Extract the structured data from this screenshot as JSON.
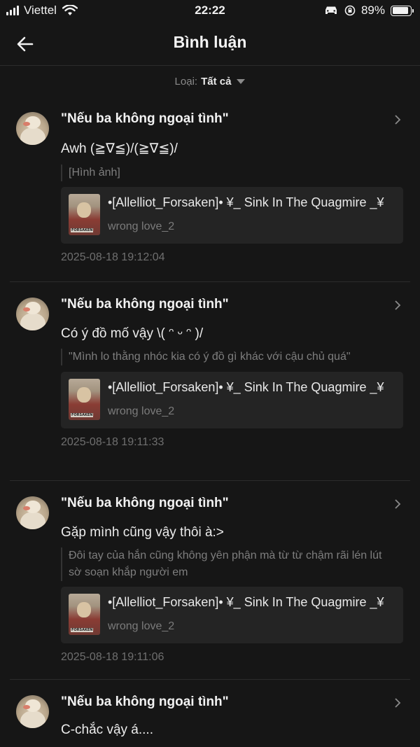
{
  "status_bar": {
    "carrier": "Viettel",
    "time": "22:22",
    "battery": "89%",
    "battery_level": 0.89
  },
  "header": {
    "title": "Bình luận"
  },
  "filter": {
    "label": "Loại:",
    "value": "Tất cả"
  },
  "comments": [
    {
      "chapter": "\"Nếu ba không ngoại tình\"",
      "text": "Awh (≧∇≦)/(≧∇≦)/",
      "quote": "[Hình ảnh]",
      "story_title": "•[Allelliot_Forsaken]• ¥_ Sink In The Quagmire _¥",
      "story_sub": "wrong love_2",
      "timestamp": "2025-08-18 19:12:04"
    },
    {
      "chapter": "\"Nếu ba không ngoại tình\"",
      "text": "Có ý đồ mố vậy \\( ᵔ ᵕ ᵔ )/",
      "quote": "\"Mình lo thằng nhóc kia có ý đồ gì khác với cậu chủ quá\"",
      "story_title": "•[Allelliot_Forsaken]• ¥_ Sink In The Quagmire _¥",
      "story_sub": "wrong love_2",
      "timestamp": "2025-08-18 19:11:33"
    },
    {
      "chapter": "\"Nếu ba không ngoại tình\"",
      "text": "Gặp mình cũng vậy thôi à:>",
      "quote": "Đôi tay của hắn cũng không yên phận mà từ từ chậm rãi lén lút sờ soạn khắp người em",
      "story_title": "•[Allelliot_Forsaken]• ¥_ Sink In The Quagmire _¥",
      "story_sub": "wrong love_2",
      "timestamp": "2025-08-18 19:11:06"
    },
    {
      "chapter": "\"Nếu ba không ngoại tình\"",
      "text": "C-chắc vậy á...."
    }
  ],
  "icons": {
    "back": "back-arrow-icon",
    "chevron": "chevron-right-icon",
    "filter_caret": "caret-down-icon"
  }
}
